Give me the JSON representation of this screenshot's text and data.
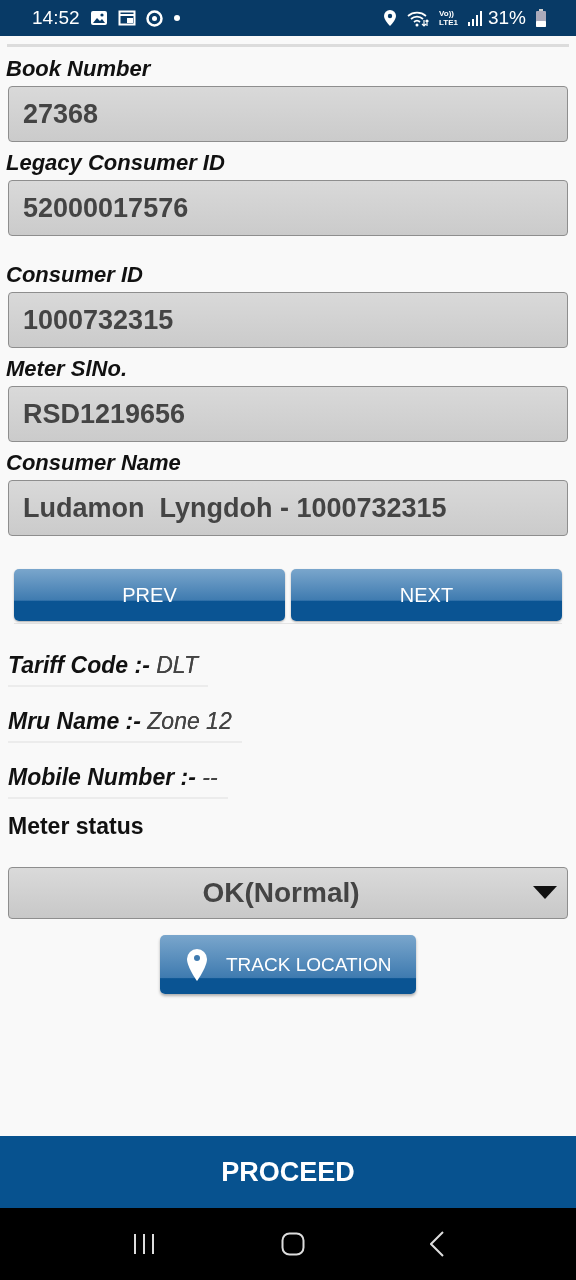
{
  "status_bar": {
    "time": "14:52",
    "network_label": [
      "Vo))",
      "LTE1"
    ],
    "battery": "31%"
  },
  "fields": [
    {
      "label": "Book Number",
      "value": "27368"
    },
    {
      "label": "Legacy Consumer ID",
      "value": "52000017576"
    },
    {
      "label": "Consumer ID",
      "value": "1000732315"
    },
    {
      "label": "Meter SlNo.",
      "value": "RSD1219656"
    },
    {
      "label": "Consumer Name",
      "value": "Ludamon  Lyngdoh - 1000732315"
    }
  ],
  "pager_buttons": [
    "PREV",
    "NEXT"
  ],
  "details": [
    {
      "label": "Tariff Code :-",
      "value": "DLT"
    },
    {
      "label": "Mru Name :-",
      "value": "Zone 12"
    },
    {
      "label": "Mobile Number :-",
      "value": "--"
    }
  ],
  "meter_status": {
    "label": "Meter status",
    "value": "OK(Normal)"
  },
  "track_button": "TRACK LOCATION",
  "proceed_button": "PROCEED"
}
